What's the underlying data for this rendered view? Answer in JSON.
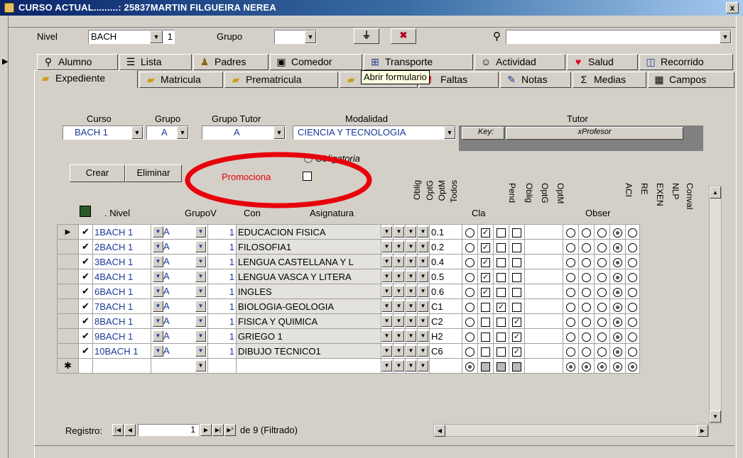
{
  "window": {
    "title": "CURSO ACTUAL.........: 25837MARTIN FILGUEIRA NEREA",
    "close_glyph": "x"
  },
  "filter": {
    "nivel_label": "Nivel",
    "nivel_value": "BACH",
    "nivel_extra": "1",
    "grupo_label": "Grupo",
    "grupo_value": "",
    "search_value": ""
  },
  "tabs_row1": [
    {
      "label": "Alumno",
      "icon": "search-icon"
    },
    {
      "label": "Lista",
      "icon": "list-icon"
    },
    {
      "label": "Padres",
      "icon": "parents-icon"
    },
    {
      "label": "Comedor",
      "icon": "comedor-icon"
    },
    {
      "label": "Transporte",
      "icon": "transport-icon"
    },
    {
      "label": "Actividad",
      "icon": "activity-icon"
    },
    {
      "label": "Salud",
      "icon": "heart-icon"
    },
    {
      "label": "Recorrido",
      "icon": "book-icon"
    }
  ],
  "tabs_row2": [
    {
      "label": "Expediente",
      "icon": "folder-icon"
    },
    {
      "label": "Matricula",
      "icon": "folder-icon"
    },
    {
      "label": "Prematricula",
      "icon": "folder-icon"
    },
    {
      "label": "",
      "icon": "folder-icon"
    },
    {
      "label": "Faltas",
      "icon": "exclamation-icon"
    },
    {
      "label": "Notas",
      "icon": "notes-icon"
    },
    {
      "label": "Medias",
      "icon": "sigma-icon"
    },
    {
      "label": "Campos",
      "icon": "fields-icon"
    }
  ],
  "tooltip": "Abrir formulario",
  "form": {
    "curso_label": "Curso",
    "curso_value": "BACH 1",
    "grupo_label": "Grupo",
    "grupo_value": "A",
    "grupo_tutor_label": "Grupo Tutor",
    "grupo_tutor_value": "A",
    "modalidad_label": "Modalidad",
    "modalidad_value": "CIENCIA Y TECNOLOGIA",
    "tutor_label": "Tutor",
    "key_label": "Key:",
    "tutor_value": "xProfesor",
    "obligatoria_label": "Obligatoria",
    "crear_label": "Crear",
    "eliminar_label": "Eliminar",
    "promociona_label": "Promociona"
  },
  "grid": {
    "headers": {
      "nivel": ". Nivel",
      "grupov": "GrupoV",
      "con": "Con",
      "asignatura": "Asignatura",
      "cla": "Cla",
      "obser": "Obser"
    },
    "vheaders_left": [
      "Oblig",
      "OptG",
      "OptM",
      "Todos"
    ],
    "vheaders_right": [
      "Pend",
      "Oblig",
      "OptG",
      "OptM"
    ],
    "vheaders_far": [
      "ACI",
      "RE",
      "EXEN",
      "NLP",
      "Conval"
    ],
    "rows": [
      {
        "n": "1",
        "nivel": "BACH 1",
        "grupo": "A",
        "con": "1",
        "asig": "EDUCACION FISICA",
        "cla": "0.1",
        "oblig": true,
        "optg": false,
        "optm": false
      },
      {
        "n": "2",
        "nivel": "BACH 1",
        "grupo": "A",
        "con": "1",
        "asig": "FILOSOFIA1",
        "cla": "0.2",
        "oblig": true,
        "optg": false,
        "optm": false
      },
      {
        "n": "3",
        "nivel": "BACH 1",
        "grupo": "A",
        "con": "1",
        "asig": "LENGUA CASTELLANA Y L",
        "cla": "0.4",
        "oblig": true,
        "optg": false,
        "optm": false
      },
      {
        "n": "4",
        "nivel": "BACH 1",
        "grupo": "A",
        "con": "1",
        "asig": "LENGUA VASCA Y LITERA",
        "cla": "0.5",
        "oblig": true,
        "optg": false,
        "optm": false
      },
      {
        "n": "6",
        "nivel": "BACH 1",
        "grupo": "A",
        "con": "1",
        "asig": "INGLES",
        "cla": "0.6",
        "oblig": true,
        "optg": false,
        "optm": false
      },
      {
        "n": "7",
        "nivel": "BACH 1",
        "grupo": "A",
        "con": "1",
        "asig": "BIOLOGIA-GEOLOGIA",
        "cla": "C1",
        "oblig": false,
        "optg": true,
        "optm": false
      },
      {
        "n": "8",
        "nivel": "BACH 1",
        "grupo": "A",
        "con": "1",
        "asig": "FISICA Y QUIMICA",
        "cla": "C2",
        "oblig": false,
        "optg": false,
        "optm": true
      },
      {
        "n": "9",
        "nivel": "BACH 1",
        "grupo": "A",
        "con": "1",
        "asig": "GRIEGO 1",
        "cla": "H2",
        "oblig": false,
        "optg": false,
        "optm": true
      },
      {
        "n": "10",
        "nivel": "BACH 1",
        "grupo": "A",
        "con": "1",
        "asig": "DIBUJO TECNICO1",
        "cla": "C6",
        "oblig": false,
        "optg": false,
        "optm": true
      }
    ]
  },
  "nav": {
    "registro_label": "Registro:",
    "current": "1",
    "total_text": "de 9 (Filtrado)"
  },
  "annotation_color": "#e8000a"
}
